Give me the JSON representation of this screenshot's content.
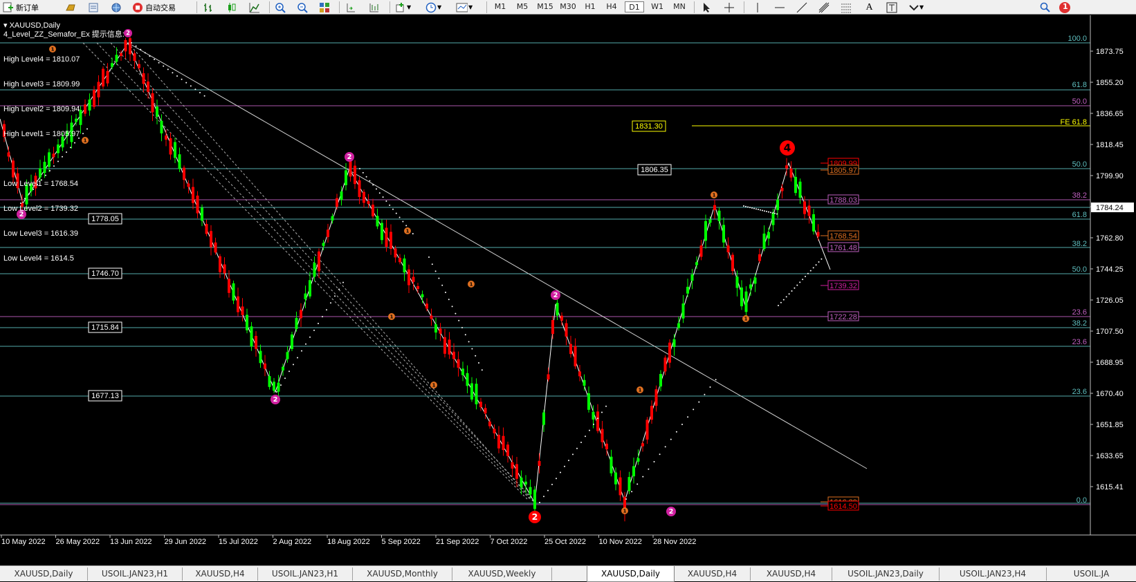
{
  "toolbar": {
    "new_order": "新订单",
    "auto_trading": "自动交易",
    "timeframes": [
      "M1",
      "M5",
      "M15",
      "M30",
      "H1",
      "H4",
      "D1",
      "W1",
      "MN"
    ],
    "active_timeframe": "D1",
    "alert_count": "1"
  },
  "chart": {
    "symbol_label": "XAUUSD,Daily",
    "indicator_label": "4_Level_ZZ_Semafor_Ex 提示信息:",
    "levels_text": [
      "High Level4 = 1810.07",
      "High Level3 = 1809.99",
      "High Level2 = 1809.94",
      "High Level1 = 1805.97",
      "",
      "Low Level1 = 1768.54",
      "Low Level2 = 1739.32",
      "Low Level3 = 1616.39",
      "Low Level4 = 1614.5"
    ],
    "y_axis": {
      "ticks": [
        "1873.75",
        "1855.20",
        "1836.65",
        "1818.45",
        "1799.90",
        "1781.35",
        "1762.80",
        "1744.25",
        "1726.05",
        "1707.50",
        "1688.95",
        "1670.40",
        "1651.85",
        "1633.65",
        "1615.41"
      ],
      "current_price": "1784.24"
    },
    "x_axis": {
      "labels": [
        "10 May 2022",
        "26 May 2022",
        "13 Jun 2022",
        "29 Jun 2022",
        "15 Jul 2022",
        "2 Aug 2022",
        "18 Aug 2022",
        "5 Sep 2022",
        "21 Sep 2022",
        "7 Oct 2022",
        "25 Oct 2022",
        "10 Nov 2022",
        "28 Nov 2022"
      ]
    },
    "fib_labels_right": [
      "100.0",
      "61.8",
      "50.0",
      "50.0",
      "38.2",
      "61.8",
      "38.2",
      "50.0",
      "23.6",
      "38.2",
      "23.6",
      "23.6",
      "0.0"
    ],
    "fe_label": "FE 61.8",
    "price_boxes_left": [
      "1778.05",
      "1746.70",
      "1715.84",
      "1677.13"
    ],
    "price_box_mid": "1806.35",
    "price_box_fe": "1831.30",
    "level_price_labels": [
      "1809.99",
      "1805.97",
      "1788.03",
      "1768.54",
      "1761.48",
      "1739.32",
      "1722.28",
      "1616.39",
      "1614.50"
    ],
    "semafor_numbers": [
      "1",
      "2",
      "4"
    ],
    "colors": {
      "bull": "#00ff00",
      "bear": "#ff0000",
      "fib_teal": "#5fbfbf",
      "fib_magenta": "#c060c0",
      "fe_yellow": "#ffff00",
      "semafor_orange": "#e07020",
      "semafor_magenta": "#d020a0"
    }
  },
  "tabs": [
    "XAUUSD,Daily",
    "USOIL.JAN23,H1",
    "XAUUSD,H4",
    "USOIL.JAN23,H1",
    "XAUUSD,Monthly",
    "XAUUSD,Weekly",
    "XAUUSD,Daily",
    "XAUUSD,H4",
    "XAUUSD,H4",
    "USOIL.JAN23,Daily",
    "USOIL.JAN23,H4",
    "USOIL.JA"
  ],
  "active_tab": 6
}
